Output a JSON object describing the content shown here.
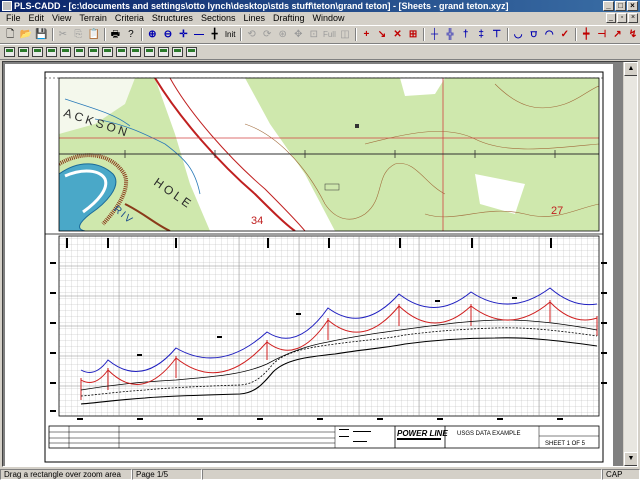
{
  "window": {
    "title": "PLS-CADD - [c:\\documents and settings\\otto lynch\\desktop\\stds stuff\\teton\\grand teton] - [Sheets - grand teton.xyz]"
  },
  "menu": [
    "File",
    "Edit",
    "View",
    "Terrain",
    "Criteria",
    "Structures",
    "Sections",
    "Lines",
    "Drafting",
    "Window"
  ],
  "toolbar": {
    "zoom_label": "Init",
    "full_label": "Full"
  },
  "map": {
    "labels": {
      "jackson": "ACKSON",
      "hole": "HOLE",
      "river": "RIV",
      "grid_num_1": "34",
      "grid_num_2": "27"
    }
  },
  "title_block": {
    "logo_text": "POWER LINE",
    "drawing_title": "USGS DATA EXAMPLE",
    "sheet_label": "SHEET 1 OF 5"
  },
  "status": {
    "message": "Drag a rectangle over zoom area",
    "page": "Page 1/5",
    "cap": "CAP"
  },
  "colors": {
    "map_green": "#cfe8ad",
    "wire_blue": "#2020c0",
    "wire_red": "#d02020",
    "grid": "#9a9a9a"
  }
}
